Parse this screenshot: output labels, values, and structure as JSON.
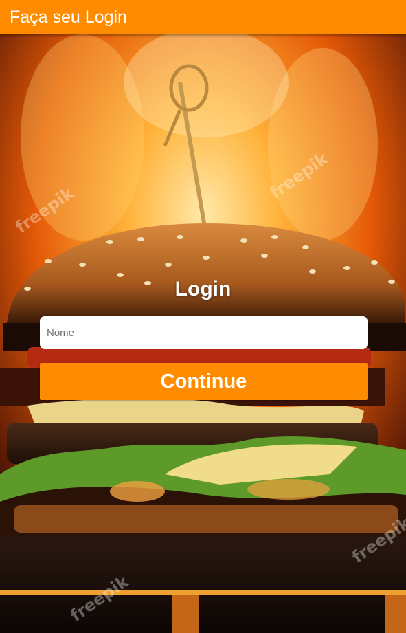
{
  "app_bar": {
    "title": "Faça seu Login"
  },
  "hero": {
    "watermark": "freepik",
    "icon": "burger-photo"
  },
  "login": {
    "title": "Login",
    "name_placeholder": "Nome",
    "name_value": "",
    "continue_label": "Continue"
  },
  "colors": {
    "accent": "#FF8C00",
    "text_on_accent": "#FFFFFF"
  }
}
